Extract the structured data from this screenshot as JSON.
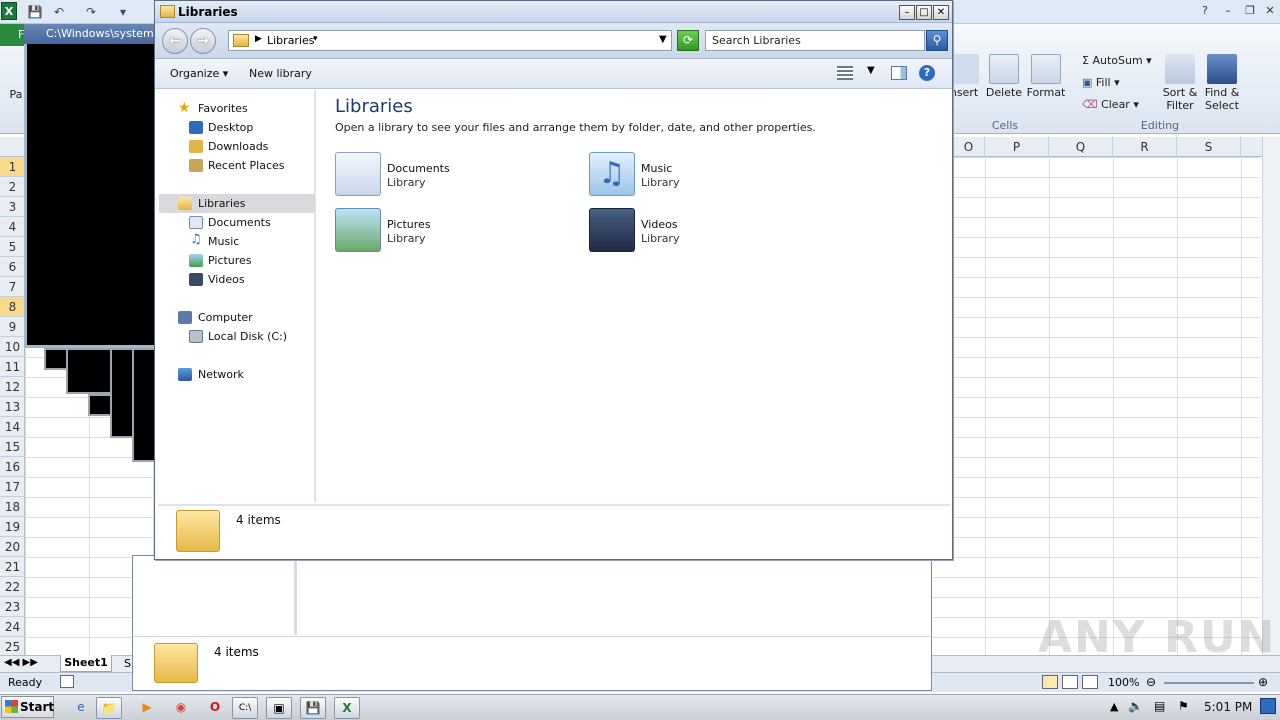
{
  "excel": {
    "logo": "X",
    "file_tab": "F",
    "ribbon": {
      "insert_label": "nsert",
      "delete_label": "Delete",
      "format_label": "Format",
      "cells_group": "Cells",
      "autosum_label": "AutoSum",
      "fill_label": "Fill",
      "clear_label": "Clear",
      "sort_line1": "Sort &",
      "sort_line2": "Filter",
      "find_line1": "Find &",
      "find_line2": "Select",
      "editing_group": "Editing",
      "paste_partial": "Pa"
    },
    "columns": [
      "O",
      "P",
      "Q",
      "R",
      "S"
    ],
    "rows": [
      "1",
      "2",
      "3",
      "4",
      "5",
      "6",
      "7",
      "8",
      "9",
      "10",
      "11",
      "12",
      "13",
      "14",
      "15",
      "16",
      "17",
      "18",
      "19",
      "20",
      "21",
      "22",
      "23",
      "24",
      "25"
    ],
    "sheet_tab": "Sheet1",
    "sheet_tab_next": "S",
    "status": "Ready",
    "zoom": "100%"
  },
  "cmd": {
    "title": "C:\\Windows\\system"
  },
  "explorer2": {
    "status_count": "4 items"
  },
  "libraries_window": {
    "title": "Libraries",
    "address": "Libraries",
    "search_placeholder": "Search Libraries",
    "toolbar": {
      "organize": "Organize",
      "new_library": "New library"
    },
    "nav": {
      "favorites": "Favorites",
      "desktop": "Desktop",
      "downloads": "Downloads",
      "recent_places": "Recent Places",
      "libraries": "Libraries",
      "documents": "Documents",
      "music": "Music",
      "pictures": "Pictures",
      "videos": "Videos",
      "computer": "Computer",
      "local_disk": "Local Disk (C:)",
      "network": "Network"
    },
    "content": {
      "heading": "Libraries",
      "description": "Open a library to see your files and arrange them by folder, date, and other properties.",
      "items": [
        {
          "name": "Documents",
          "kind": "Library"
        },
        {
          "name": "Music",
          "kind": "Library"
        },
        {
          "name": "Pictures",
          "kind": "Library"
        },
        {
          "name": "Videos",
          "kind": "Library"
        }
      ]
    },
    "details": "4 items"
  },
  "taskbar": {
    "start": "Start",
    "clock": "5:01 PM"
  },
  "watermark": "ANY RUN",
  "colors": {
    "excel_green": "#1e7a3a",
    "explorer_chrome": "#c5d5ea",
    "heading_blue": "#1f3a6b"
  }
}
